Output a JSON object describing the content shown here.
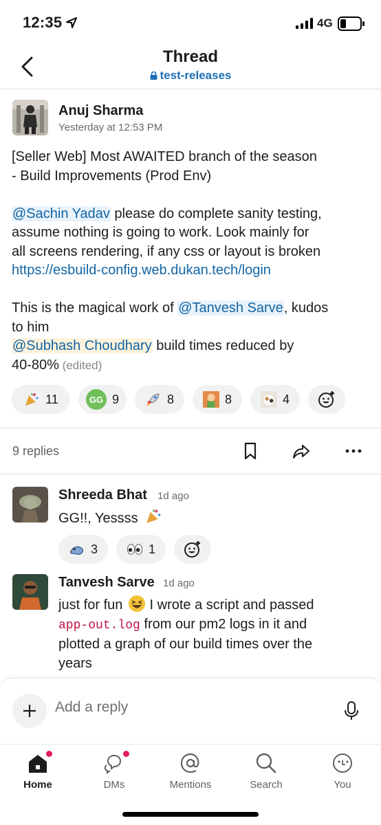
{
  "status": {
    "time": "12:35",
    "network": "4G"
  },
  "header": {
    "title": "Thread",
    "channel": "test-releases"
  },
  "root": {
    "author": "Anuj Sharma",
    "timestamp": "Yesterday at 12:53 PM",
    "line1": "[Seller Web] Most AWAITED branch of the season",
    "line2": "- Build Improvements (Prod Env)",
    "mention1": "@Sachin Yadav",
    "p2a": " please do complete sanity testing,",
    "p2b": "assume nothing is going to work. Look mainly for",
    "p2c": "all screens rendering, if any css or layout is broken",
    "link": "https://esbuild-config.web.dukan.tech/login",
    "p3a": "This is the magical work of ",
    "mention2": "@Tanvesh Sarve",
    "p3b": ", kudos",
    "p3c": "to him",
    "mention3": "@Subhash Choudhary",
    "p4a": " build times reduced by",
    "p4b": "40-80%",
    "edited": " (edited)",
    "reactions": [
      {
        "emoji": "party-popper",
        "count": "11"
      },
      {
        "emoji": "gg-badge",
        "label": "GG",
        "count": "9"
      },
      {
        "emoji": "rocket",
        "count": "8"
      },
      {
        "emoji": "cartoon-face",
        "count": "8"
      },
      {
        "emoji": "cat-photo",
        "count": "4"
      }
    ]
  },
  "replies_bar": {
    "count": "9 replies"
  },
  "replies": [
    {
      "author": "Shreeda Bhat",
      "time": "1d ago",
      "text": "GG!!, Yessss",
      "reactions": [
        {
          "emoji": "bird",
          "count": "3"
        },
        {
          "emoji": "eyes",
          "count": "1"
        }
      ]
    },
    {
      "author": "Tanvesh Sarve",
      "time": "1d ago",
      "l1a": "just for fun",
      "l1b": "  I wrote a script and passed",
      "code": "app-out.log",
      "l2b": " from our pm2 logs in it and",
      "l3": "plotted a graph of our build times over the",
      "l4": "years"
    }
  ],
  "composer": {
    "placeholder": "Add a reply"
  },
  "tabs": [
    {
      "label": "Home"
    },
    {
      "label": "DMs"
    },
    {
      "label": "Mentions"
    },
    {
      "label": "Search"
    },
    {
      "label": "You"
    }
  ],
  "colors": {
    "link": "#1264a3",
    "channel": "#1d6fb8",
    "badge": "#e01e5a",
    "gg": "#4caf50"
  }
}
